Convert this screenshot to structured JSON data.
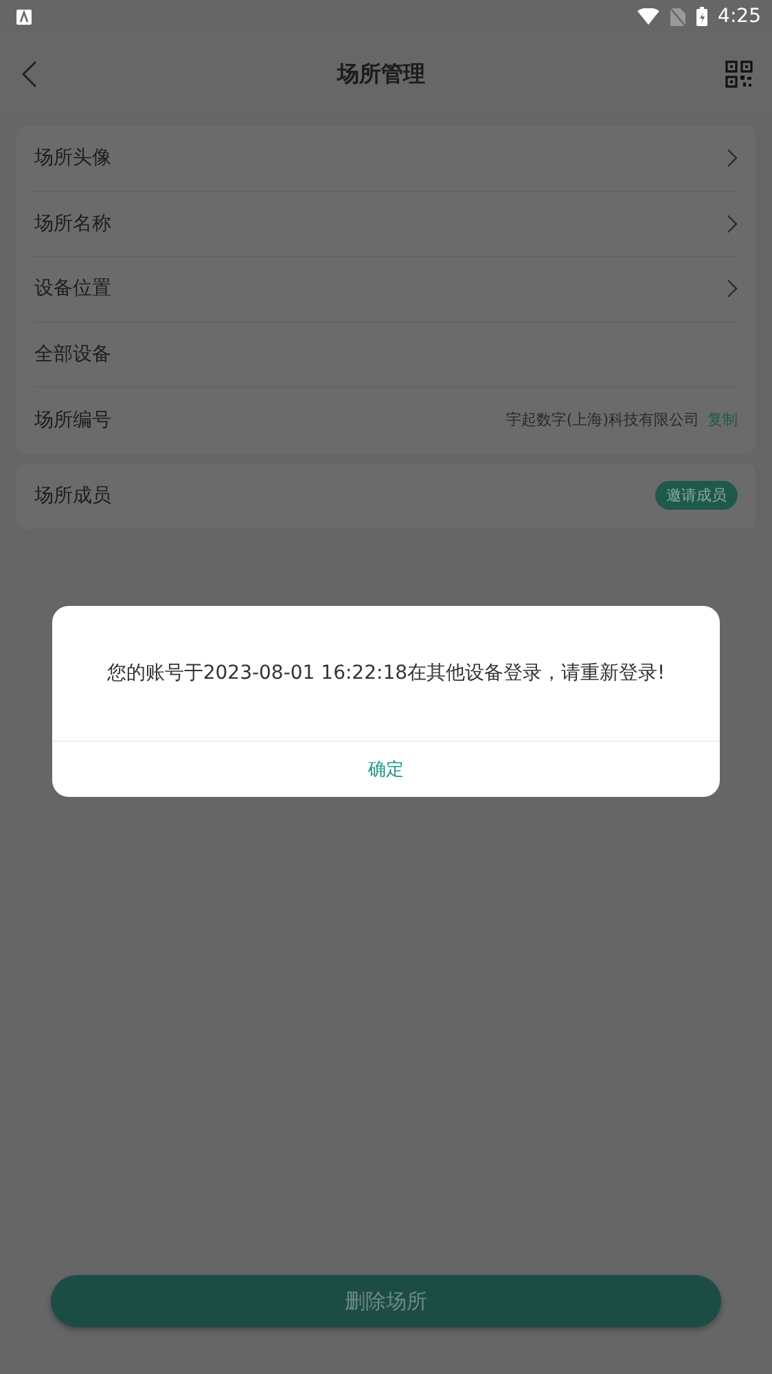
{
  "status_bar": {
    "time": "4:25"
  },
  "header": {
    "title": "场所管理"
  },
  "settings": [
    {
      "kind": "link",
      "label": "场所头像"
    },
    {
      "kind": "link",
      "label": "场所名称"
    },
    {
      "kind": "link",
      "label": "设备位置"
    },
    {
      "kind": "plain",
      "label": "全部设备"
    },
    {
      "kind": "copy",
      "label": "场所编号",
      "value": "宇起数字(上海)科技有限公司",
      "action": "复制"
    }
  ],
  "members": {
    "label": "场所成员",
    "action": "邀请成员"
  },
  "delete_button": "删除场所",
  "dialog": {
    "message": "您的账号于2023-08-01 16:22:18在其他设备登录，请重新登录!",
    "confirm": "确定"
  }
}
